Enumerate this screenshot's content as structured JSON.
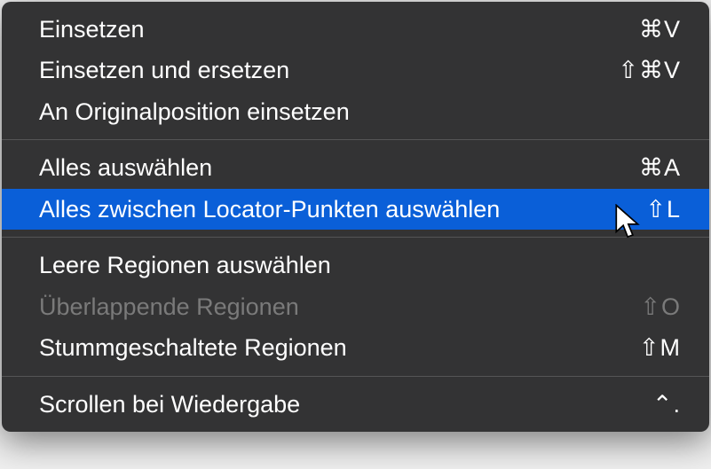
{
  "menu": {
    "groups": [
      [
        {
          "label": "Einsetzen",
          "shortcut": "⌘V",
          "disabled": false,
          "highlighted": false
        },
        {
          "label": "Einsetzen und ersetzen",
          "shortcut": "⇧⌘V",
          "disabled": false,
          "highlighted": false
        },
        {
          "label": "An Originalposition einsetzen",
          "shortcut": "",
          "disabled": false,
          "highlighted": false
        }
      ],
      [
        {
          "label": "Alles auswählen",
          "shortcut": "⌘A",
          "disabled": false,
          "highlighted": false
        },
        {
          "label": "Alles zwischen Locator-Punkten auswählen",
          "shortcut": "⇧L",
          "disabled": false,
          "highlighted": true
        }
      ],
      [
        {
          "label": "Leere Regionen auswählen",
          "shortcut": "",
          "disabled": false,
          "highlighted": false
        },
        {
          "label": "Überlappende Regionen",
          "shortcut": "⇧O",
          "disabled": true,
          "highlighted": false
        },
        {
          "label": "Stummgeschaltete Regionen",
          "shortcut": "⇧M",
          "disabled": false,
          "highlighted": false
        }
      ],
      [
        {
          "label": "Scrollen bei Wiedergabe",
          "shortcut": "⌃.",
          "disabled": false,
          "highlighted": false
        }
      ]
    ]
  }
}
